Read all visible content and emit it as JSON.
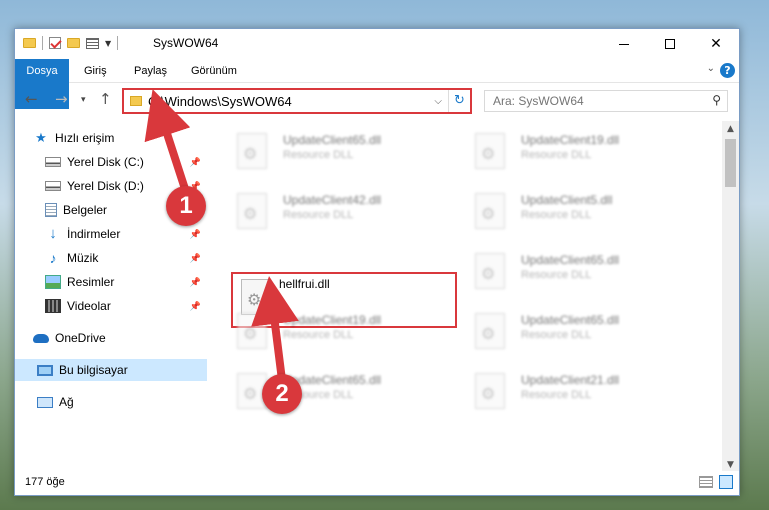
{
  "window": {
    "title": "SysWOW64",
    "controls": {
      "minimize": "minimize",
      "maximize": "maximize",
      "close": "✕"
    }
  },
  "ribbon": {
    "tabs": [
      {
        "label": "Dosya"
      },
      {
        "label": "Giriş"
      },
      {
        "label": "Paylaş"
      },
      {
        "label": "Görünüm"
      }
    ],
    "help_label": "?"
  },
  "nav": {
    "back": "←",
    "forward": "→",
    "recent": "▾",
    "up": "↑",
    "address": "C:\\Windows\\SysWOW64",
    "refresh": "↻",
    "search_placeholder": "Ara: SysWOW64"
  },
  "sidebar": {
    "items": [
      {
        "label": "Hızlı erişim",
        "icon": "star-icon"
      },
      {
        "label": "Yerel Disk (C:)",
        "icon": "disk-icon",
        "pinned": true
      },
      {
        "label": "Yerel Disk (D:)",
        "icon": "disk-icon",
        "pinned": true
      },
      {
        "label": "Belgeler",
        "icon": "document-icon",
        "pinned": true
      },
      {
        "label": "İndirmeler",
        "icon": "download-icon",
        "pinned": true
      },
      {
        "label": "Müzik",
        "icon": "music-icon",
        "pinned": true
      },
      {
        "label": "Resimler",
        "icon": "pictures-icon",
        "pinned": true
      },
      {
        "label": "Videolar",
        "icon": "videos-icon",
        "pinned": true
      },
      {
        "label": "OneDrive",
        "icon": "onedrive-icon"
      },
      {
        "label": "Bu bilgisayar",
        "icon": "computer-icon",
        "selected": true
      },
      {
        "label": "Ağ",
        "icon": "network-icon"
      }
    ]
  },
  "files": [
    {
      "name": "UpdateClient65.dll",
      "type": "Resource DLL"
    },
    {
      "name": "UpdateClient19.dll",
      "type": "Resource DLL"
    },
    {
      "name": "UpdateClient42.dll",
      "type": "Resource DLL"
    },
    {
      "name": "UpdateClient5.dll",
      "type": "Resource DLL"
    },
    {
      "name": "hellfrui.dll",
      "type": ""
    },
    {
      "name": "UpdateClient65.dll",
      "type": "Resource DLL"
    },
    {
      "name": "UpdateClient19.dll",
      "type": "Resource DLL"
    },
    {
      "name": "UpdateClient65.dll",
      "type": "Resource DLL"
    },
    {
      "name": "UpdateClient65.dll",
      "type": "Resource DLL"
    },
    {
      "name": "UpdateClient21.dll",
      "type": "Resource DLL"
    }
  ],
  "status": {
    "item_count": "177 öğe"
  },
  "annotations": {
    "step1": "1",
    "step2": "2",
    "color": "#d9383c"
  }
}
